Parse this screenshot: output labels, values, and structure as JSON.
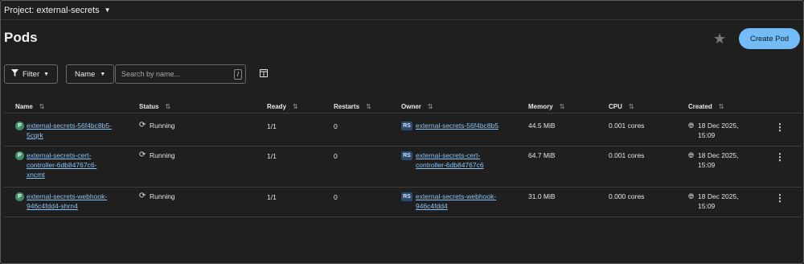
{
  "project_bar": {
    "label": "Project: external-secrets"
  },
  "page": {
    "title": "Pods",
    "create_label": "Create Pod"
  },
  "toolbar": {
    "filter_label": "Filter",
    "name_select": "Name",
    "search_placeholder": "Search by name...",
    "search_key": "/"
  },
  "table": {
    "headers": {
      "name": "Name",
      "status": "Status",
      "ready": "Ready",
      "restarts": "Restarts",
      "owner": "Owner",
      "memory": "Memory",
      "cpu": "CPU",
      "created": "Created"
    },
    "rows": [
      {
        "badge": "P",
        "name_l1": "external-secrets-56f4bc8b5-",
        "name_l2": "5cqrk",
        "status": "Running",
        "ready": "1/1",
        "restarts": "0",
        "owner_badge": "RS",
        "owner_l1": "external-secrets-56f4bc8b5",
        "owner_l2": "",
        "memory": "44.5 MiB",
        "cpu": "0.001 cores",
        "created_l1": "18 Dec 2025,",
        "created_l2": "15:09"
      },
      {
        "badge": "P",
        "name_l1": "external-secrets-cert-",
        "name_l2": "controller-6db84767c6-",
        "name_l3": "xncmt",
        "status": "Running",
        "ready": "1/1",
        "restarts": "0",
        "owner_badge": "RS",
        "owner_l1": "external-secrets-cert-",
        "owner_l2": "controller-6db84767c6",
        "memory": "64.7 MiB",
        "cpu": "0.001 cores",
        "created_l1": "18 Dec 2025,",
        "created_l2": "15:09"
      },
      {
        "badge": "P",
        "name_l1": "external-secrets-webhook-",
        "name_l2": "946c4fdd4-shrn4",
        "status": "Running",
        "ready": "1/1",
        "restarts": "0",
        "owner_badge": "RS",
        "owner_l1": "external-secrets-webhook-",
        "owner_l2": "946c4fdd4",
        "memory": "31.0 MiB",
        "cpu": "0.000 cores",
        "created_l1": "18 Dec 2025,",
        "created_l2": "15:09"
      }
    ]
  },
  "colors": {
    "accent": "#73bcf7",
    "link": "#8ac4f5",
    "background": "#1f1f1f"
  },
  "icons": [
    "caret-down-icon",
    "star-icon",
    "filter-icon",
    "columns-icon",
    "sort-icon",
    "sync-icon",
    "globe-icon",
    "kebab-icon"
  ]
}
